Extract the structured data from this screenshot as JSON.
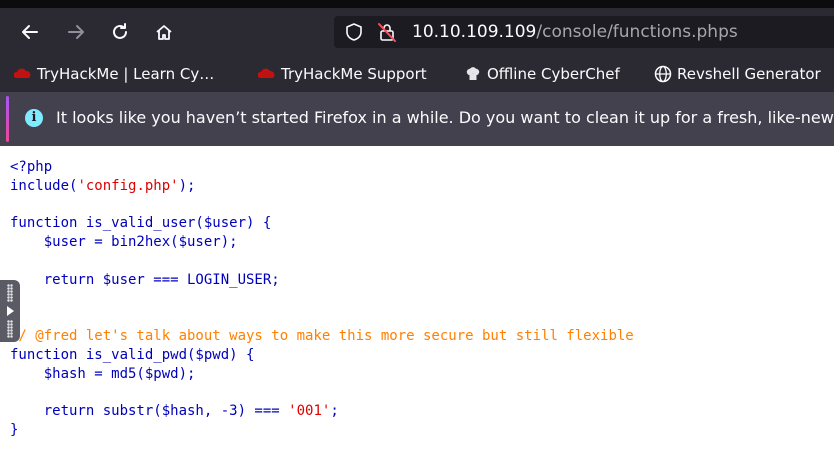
{
  "browser": {
    "url_host": "10.10.109.109",
    "url_path": "/console/functions.phps",
    "icons": [
      "back-arrow-icon",
      "forward-arrow-icon",
      "reload-icon",
      "home-icon",
      "shield-icon",
      "broken-lock-icon"
    ]
  },
  "bookmarks": [
    {
      "label": "TryHackMe | Learn Cy…",
      "icon": "tryhackme-icon"
    },
    {
      "label": "TryHackMe Support",
      "icon": "tryhackme-icon"
    },
    {
      "label": "Offline CyberChef",
      "icon": "chef-hat-icon"
    },
    {
      "label": "Revshell Generator",
      "icon": "globe-icon"
    }
  ],
  "notification": {
    "message": "It looks like you haven’t started Firefox in a while. Do you want to clean it up for a fresh, like-new"
  },
  "code": {
    "l1": "<?php",
    "l2a": "include(",
    "l2b": "'config.php'",
    "l2c": ");",
    "l4": "function is_valid_user($user) {",
    "l5": "    $user = bin2hex($user);",
    "l7": "    return $user === LOGIN_USER;",
    "l8": "}",
    "l10": "// @fred let's talk about ways to make this more secure but still flexible",
    "l11": "function is_valid_pwd($pwd) {",
    "l12": "    $hash = md5($pwd);",
    "l14a": "    return substr($hash, -3) === ",
    "l14b": "'001'",
    "l14c": ";",
    "l15": "}"
  }
}
